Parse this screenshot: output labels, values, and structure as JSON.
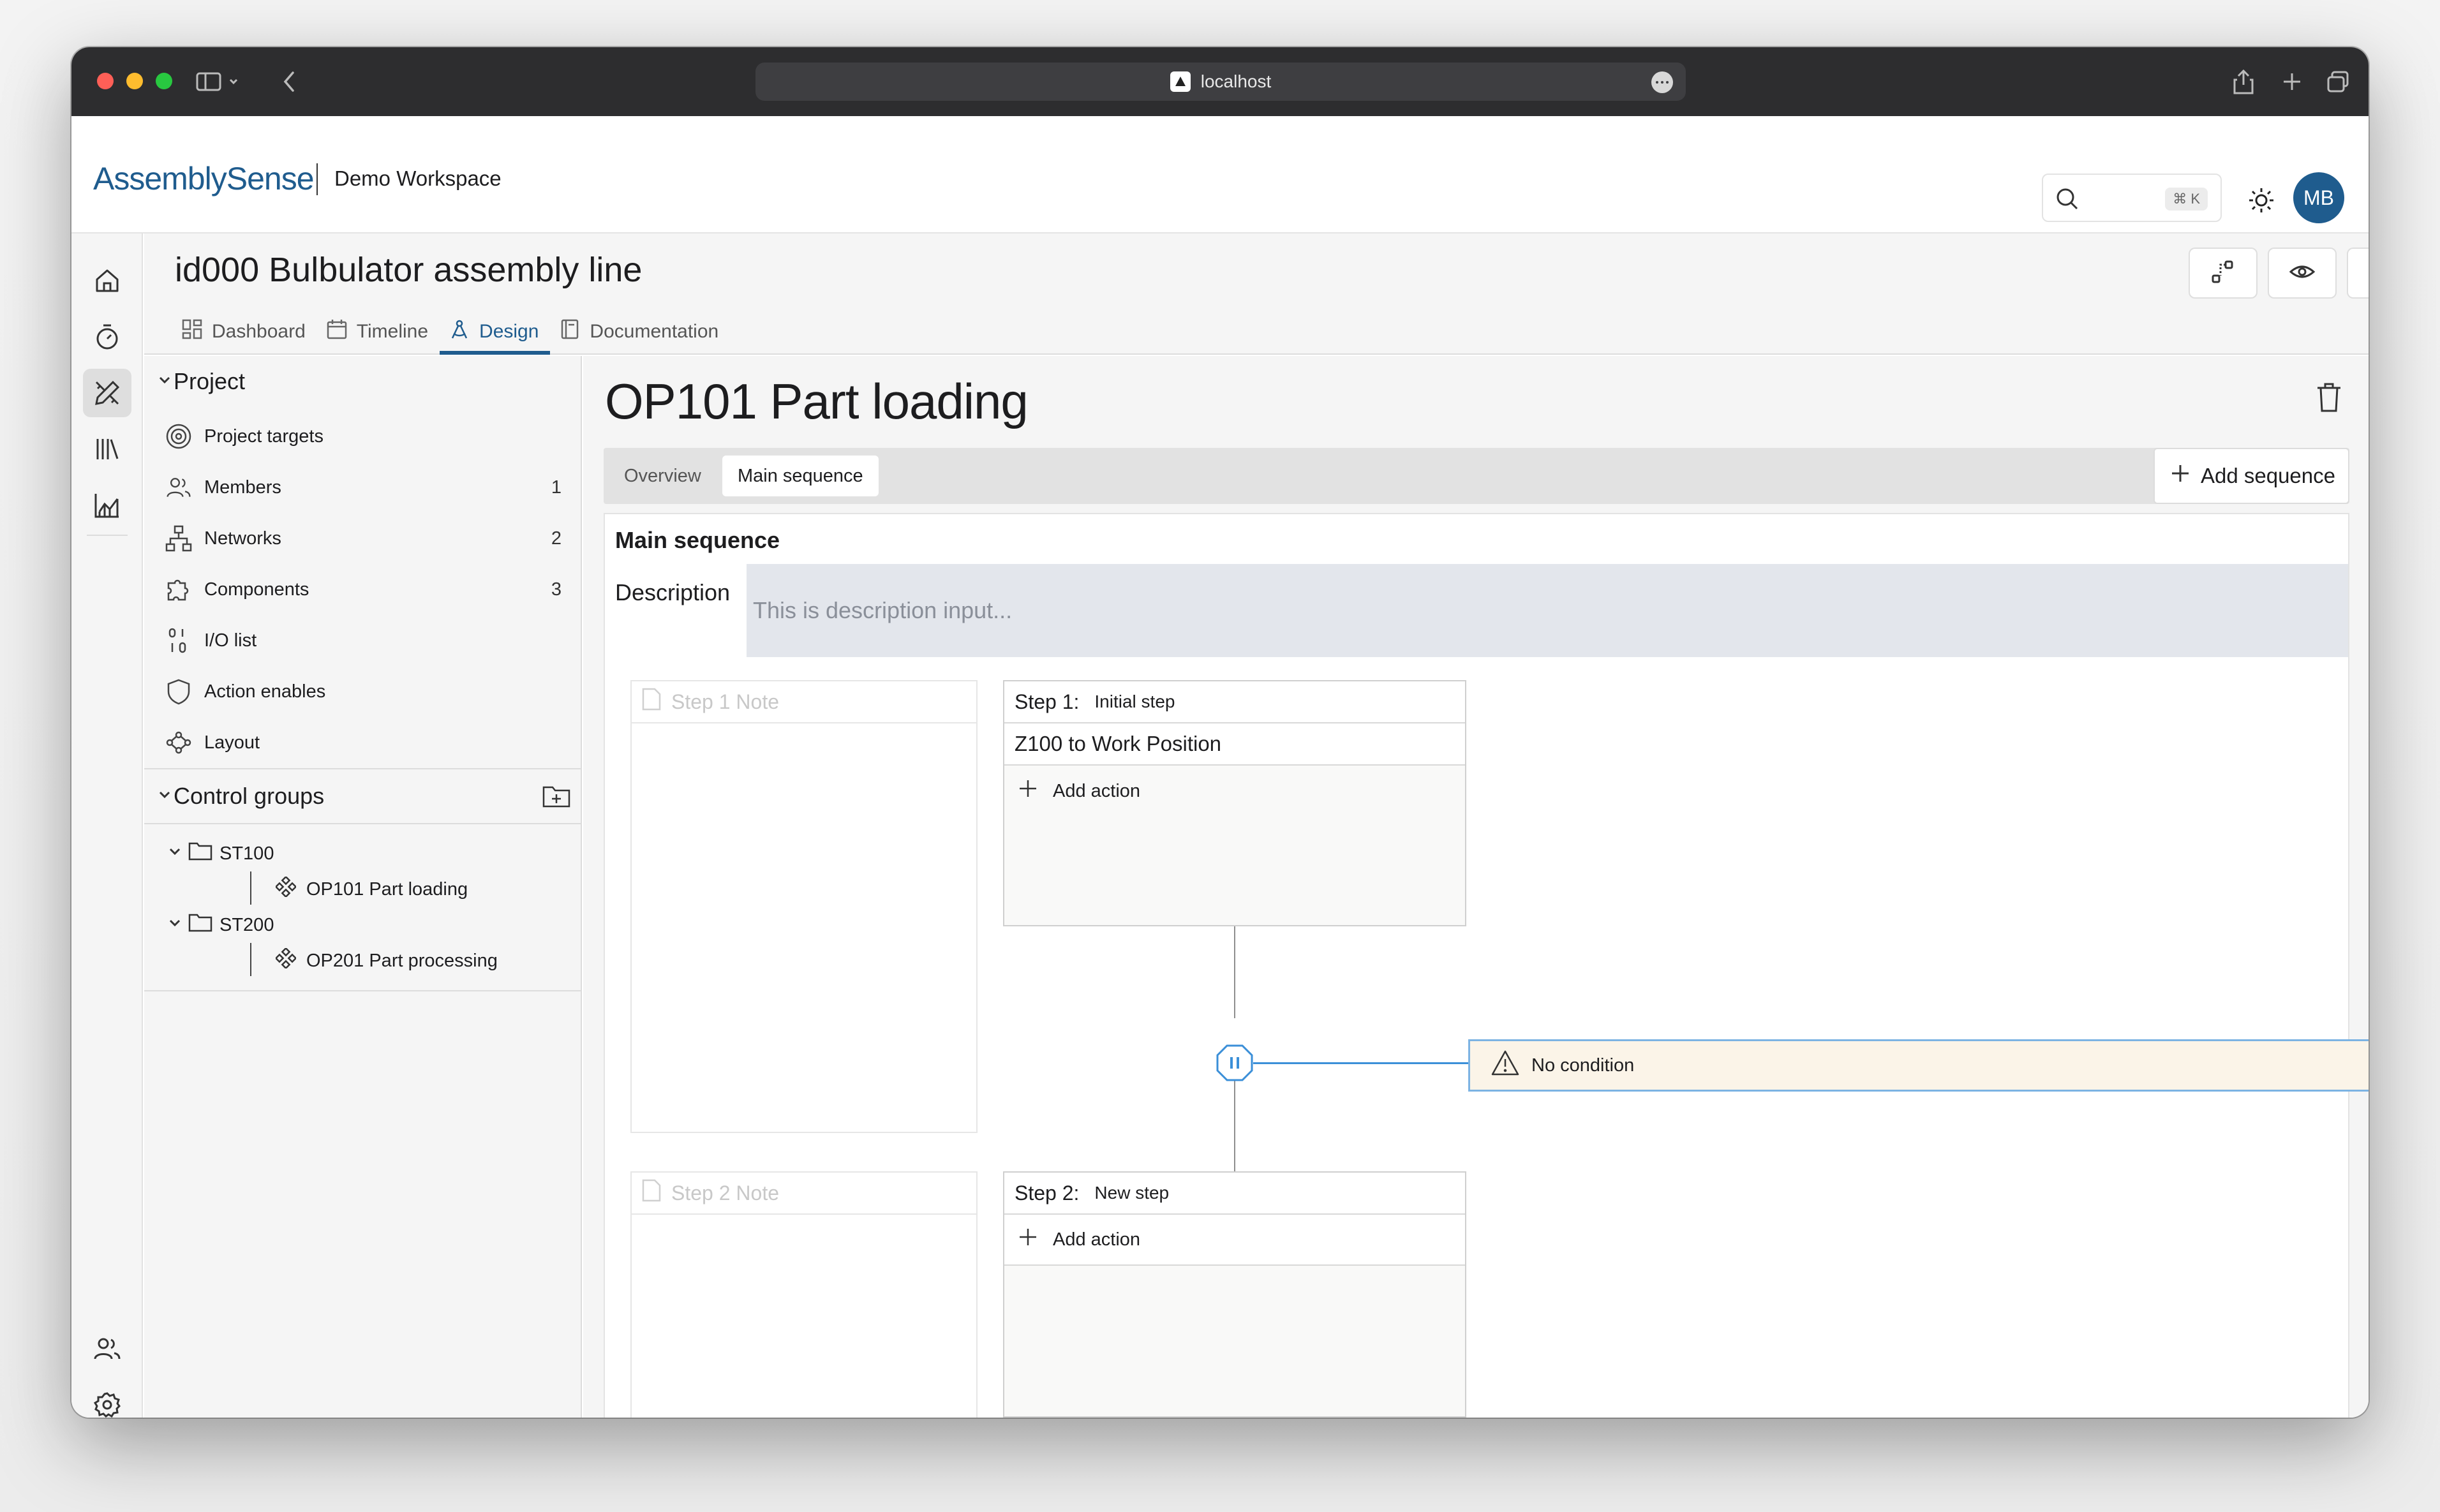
{
  "browser": {
    "url": "localhost",
    "traffic_colors": [
      "#ff5f57",
      "#febc2e",
      "#28c840"
    ]
  },
  "header": {
    "logo": "AssemblySense",
    "workspace": "Demo Workspace",
    "search_shortcut": "⌘ K",
    "avatar_initials": "MB",
    "brand_color": "#1f5c8e"
  },
  "project": {
    "id": "id000",
    "name": "Bulbulator assembly line",
    "tabs": [
      {
        "label": "Dashboard",
        "icon": "dashboard-icon"
      },
      {
        "label": "Timeline",
        "icon": "calendar-icon"
      },
      {
        "label": "Design",
        "icon": "design-icon",
        "active": true
      },
      {
        "label": "Documentation",
        "icon": "book-icon"
      }
    ]
  },
  "sidebar": {
    "project_title": "Project",
    "items": [
      {
        "label": "Project targets",
        "icon": "target-icon",
        "count": ""
      },
      {
        "label": "Members",
        "icon": "members-icon",
        "count": "1"
      },
      {
        "label": "Networks",
        "icon": "network-icon",
        "count": "2"
      },
      {
        "label": "Components",
        "icon": "puzzle-icon",
        "count": "3"
      },
      {
        "label": "I/O list",
        "icon": "io-list-icon",
        "count": ""
      },
      {
        "label": "Action enables",
        "icon": "shield-icon",
        "count": ""
      },
      {
        "label": "Layout",
        "icon": "layout-icon",
        "count": ""
      }
    ],
    "control_groups_title": "Control groups",
    "tree": [
      {
        "label": "ST100",
        "children": [
          "OP101 Part loading"
        ]
      },
      {
        "label": "ST200",
        "children": [
          "OP201 Part processing"
        ]
      }
    ]
  },
  "main": {
    "op_id": "OP101",
    "op_name": "Part loading",
    "seq_tabs": [
      "Overview",
      "Main sequence"
    ],
    "active_seq_tab": "Main sequence",
    "add_sequence": "Add sequence",
    "sequence_name": "Main sequence",
    "description_label": "Description",
    "description_placeholder": "This is description input...",
    "steps": [
      {
        "number": "Step 1:",
        "name": "Initial step",
        "note_placeholder": "Step 1 Note",
        "actions": [
          "Z100 to Work Position"
        ],
        "add_action": "Add action"
      },
      {
        "number": "Step 2:",
        "name": "New step",
        "note_placeholder": "Step 2 Note",
        "actions": [],
        "add_action": "Add action"
      }
    ],
    "transition": {
      "condition": "No condition"
    }
  }
}
